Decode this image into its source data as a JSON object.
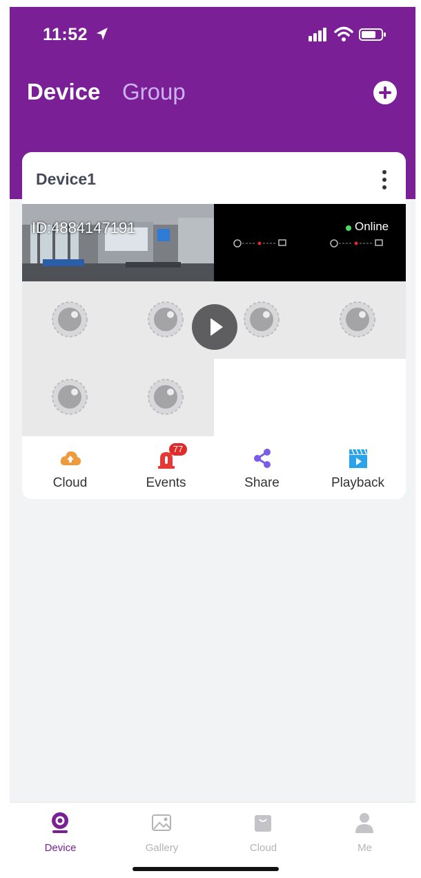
{
  "status_bar": {
    "time": "11:52"
  },
  "header": {
    "tab_device": "Device",
    "tab_group": "Group",
    "add_icon": "plus-circle-icon"
  },
  "device_card": {
    "name": "Device1",
    "id_text": "ID:4884147191",
    "status": "Online",
    "status_color": "#4cd964",
    "channel_count": 6,
    "actions": [
      {
        "label": "Cloud",
        "icon": "cloud-icon",
        "color": "#f09a3e"
      },
      {
        "label": "Events",
        "icon": "alarm-icon",
        "badge": "77",
        "color": "#e53935"
      },
      {
        "label": "Share",
        "icon": "share-icon",
        "color": "#7b5ce6"
      },
      {
        "label": "Playback",
        "icon": "playback-icon",
        "color": "#2aa3e8"
      }
    ]
  },
  "tab_bar": {
    "items": [
      {
        "label": "Device",
        "icon": "camera-icon",
        "active": true
      },
      {
        "label": "Gallery",
        "icon": "gallery-icon",
        "active": false
      },
      {
        "label": "Cloud",
        "icon": "cloud-bag-icon",
        "active": false
      },
      {
        "label": "Me",
        "icon": "person-icon",
        "active": false
      }
    ]
  },
  "colors": {
    "brand": "#7a1f95",
    "brand_light": "#cdb0f0",
    "background": "#f2f3f5"
  }
}
